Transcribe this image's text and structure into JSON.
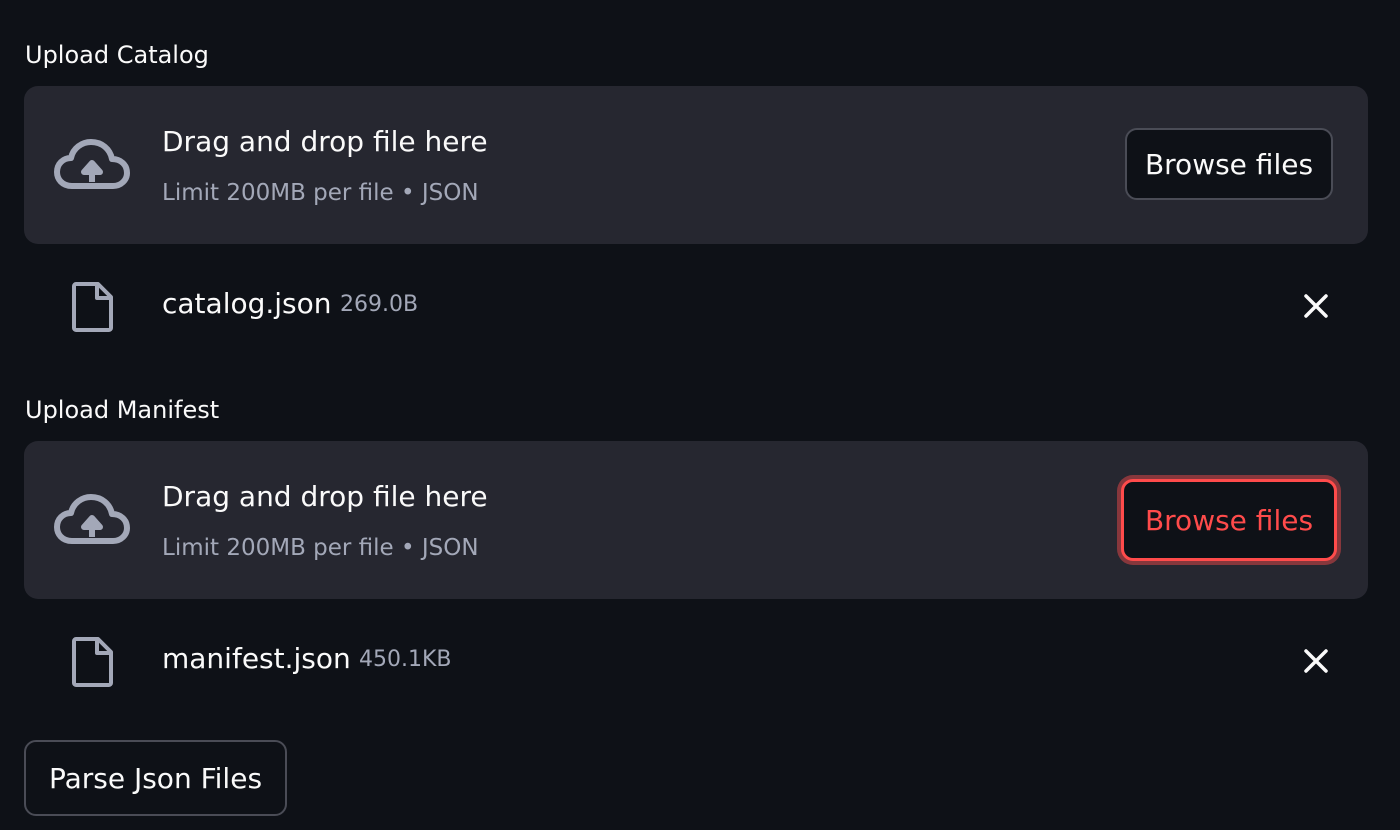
{
  "uploaders": [
    {
      "label": "Upload Catalog",
      "dropzone": {
        "title": "Drag and drop file here",
        "limit": "Limit 200MB per file • JSON",
        "browse_label": "Browse files",
        "icon": "cloud-upload-icon"
      },
      "file": {
        "name": "catalog.json",
        "size": "269.0B",
        "icon": "file-icon"
      }
    },
    {
      "label": "Upload Manifest",
      "dropzone": {
        "title": "Drag and drop file here",
        "limit": "Limit 200MB per file • JSON",
        "browse_label": "Browse files",
        "icon": "cloud-upload-icon"
      },
      "file": {
        "name": "manifest.json",
        "size": "450.1KB",
        "icon": "file-icon"
      }
    }
  ],
  "actions": {
    "parse_label": "Parse Json Files"
  },
  "colors": {
    "background": "#0e1117",
    "dropzone": "#262730",
    "text": "#fafafa",
    "muted_text": "#a3a8b8",
    "accent": "#ff4b4b"
  }
}
